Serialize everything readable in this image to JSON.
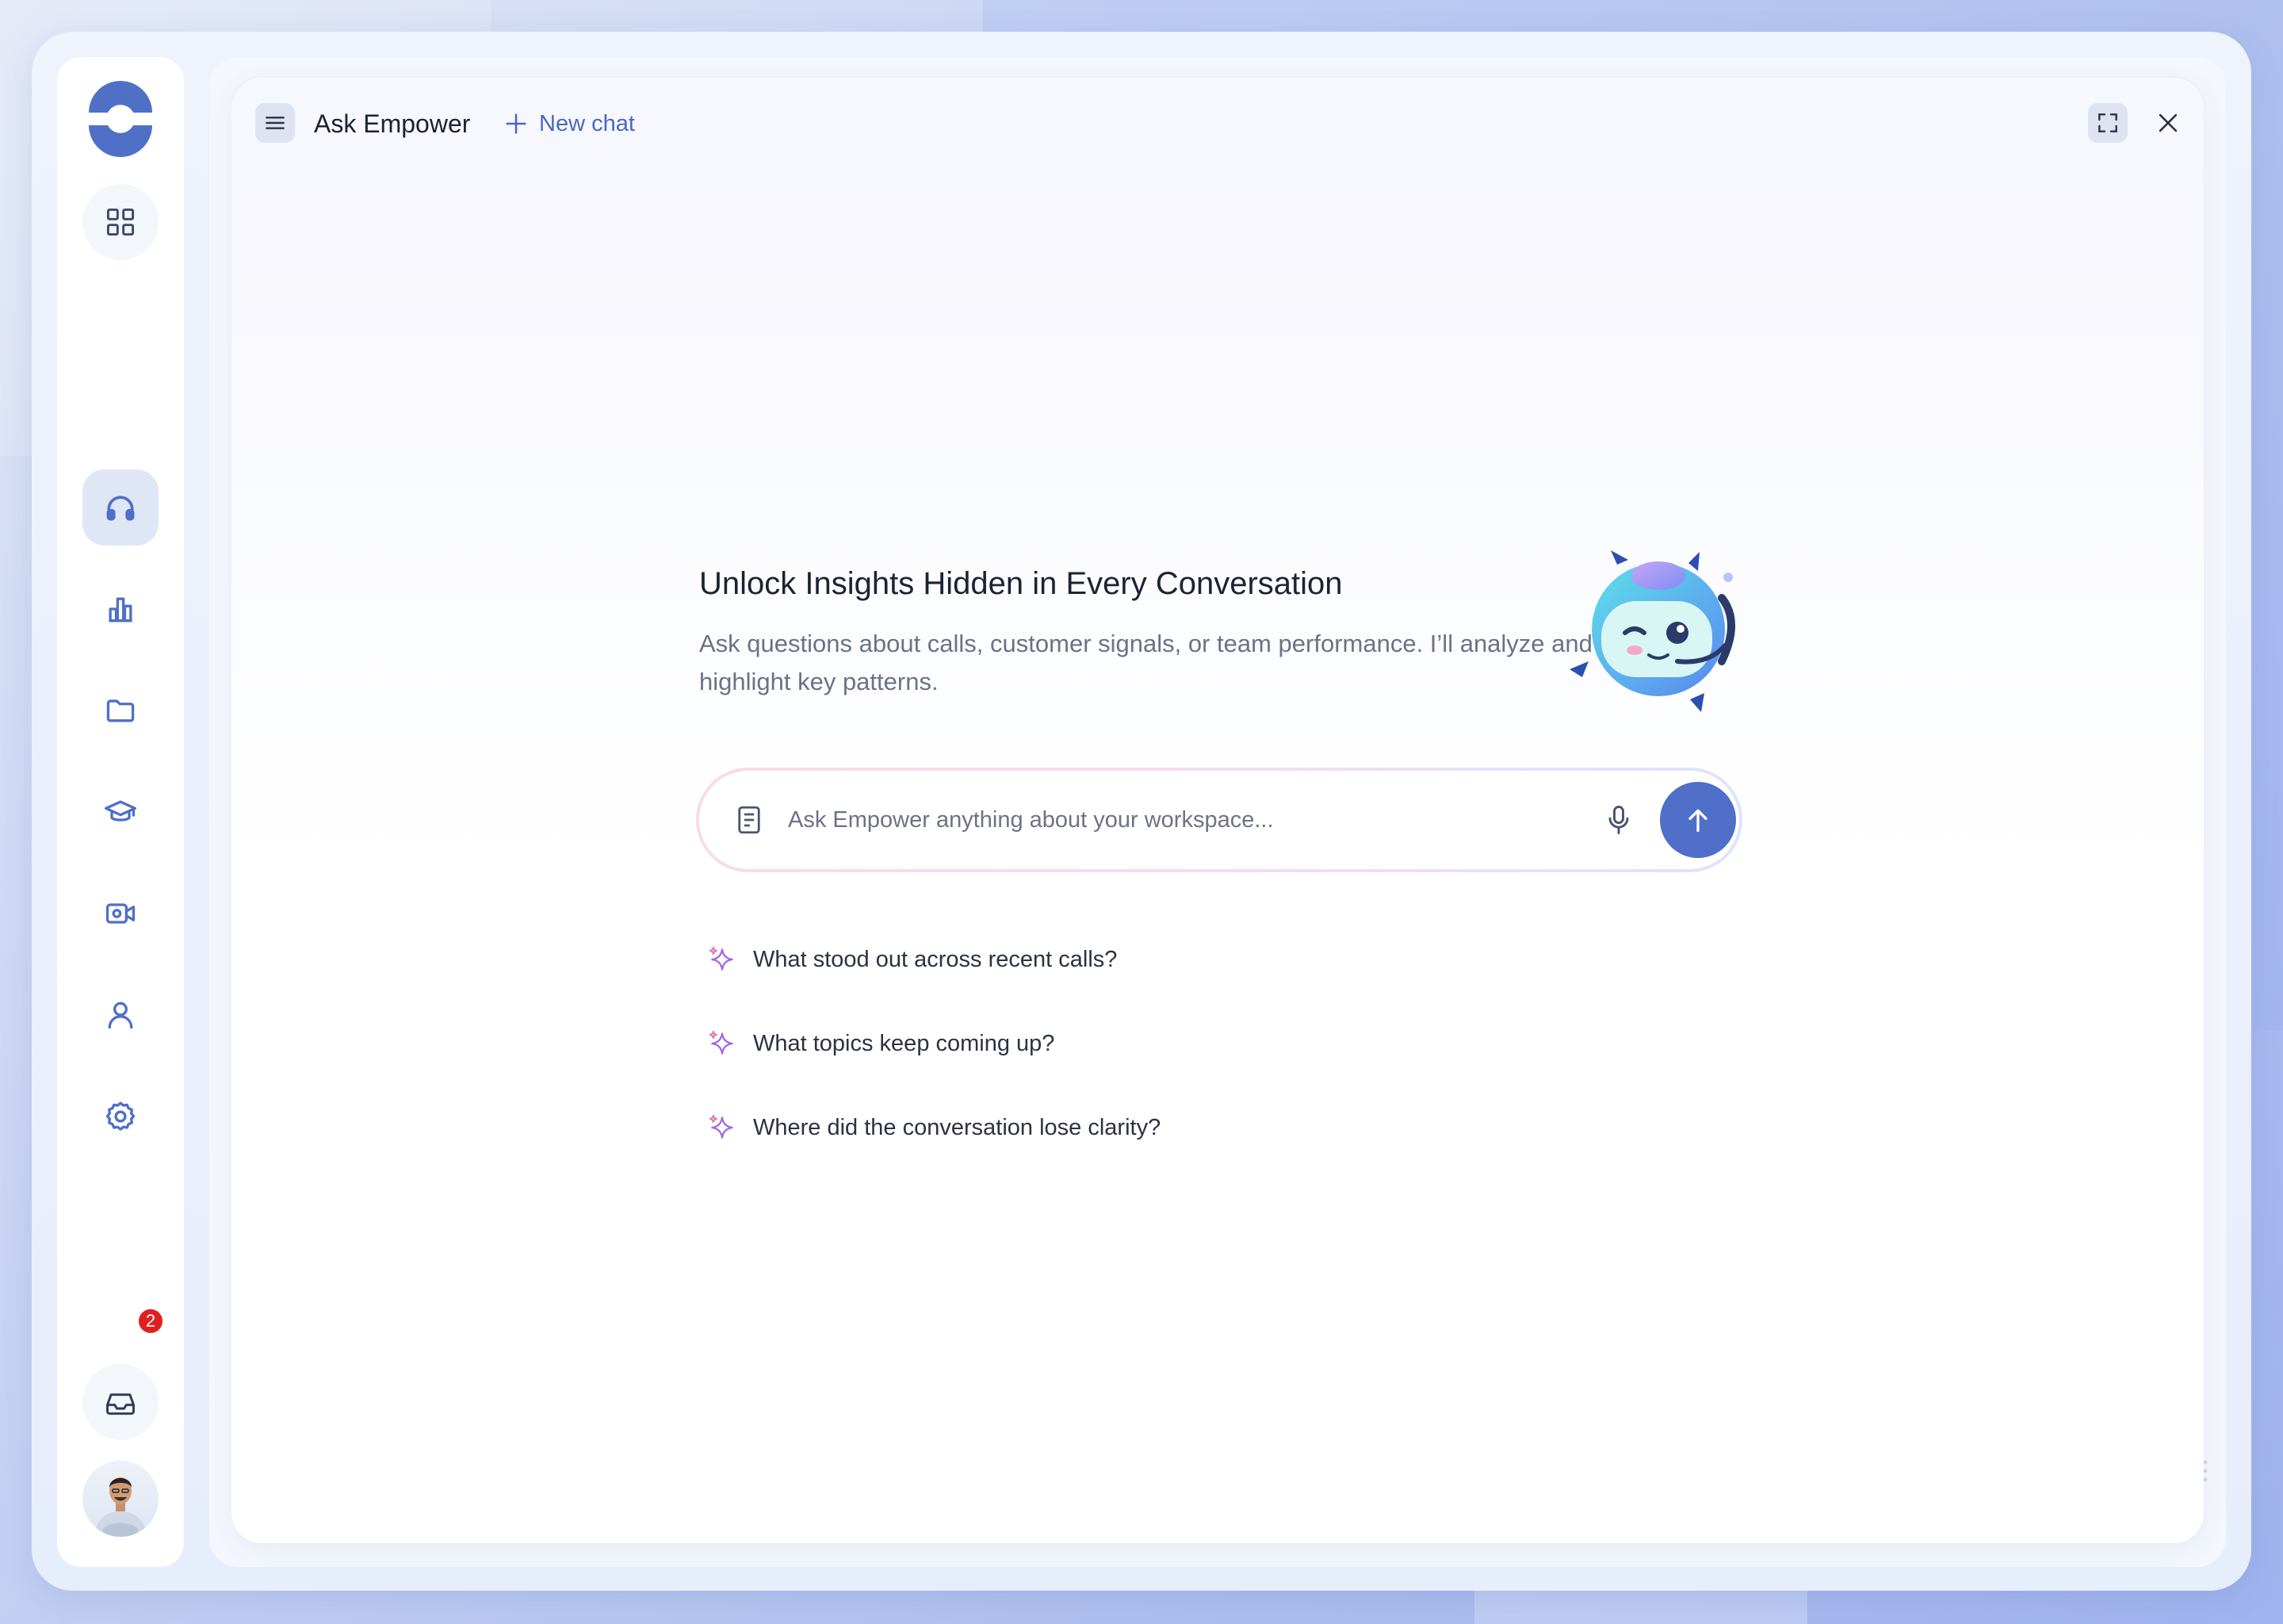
{
  "app": {
    "title": "Ask Empower",
    "new_chat_label": "New chat"
  },
  "sidebar": {
    "items": [
      {
        "name": "dashboard",
        "icon": "grid-icon"
      },
      {
        "name": "calls",
        "icon": "headphones-icon",
        "active": true
      },
      {
        "name": "analytics",
        "icon": "bar-chart-icon"
      },
      {
        "name": "library",
        "icon": "folder-icon"
      },
      {
        "name": "training",
        "icon": "graduation-cap-icon"
      },
      {
        "name": "recordings",
        "icon": "video-camera-icon"
      },
      {
        "name": "profile",
        "icon": "user-icon"
      },
      {
        "name": "settings",
        "icon": "gear-icon"
      }
    ],
    "inbox": {
      "icon": "inbox-icon",
      "badge_count": "2"
    }
  },
  "hero": {
    "title": "Unlock Insights Hidden in Every Conversation",
    "subtitle": "Ask questions about calls, customer signals, or team performance. I’ll analyze and highlight key patterns."
  },
  "composer": {
    "placeholder": "Ask Empower anything about your workspace...",
    "value": ""
  },
  "suggestions": [
    "What stood out across recent calls?",
    "What topics keep coming up?",
    "Where did the conversation lose clarity?"
  ],
  "colors": {
    "accent": "#4f6fc8",
    "badge": "#e02020",
    "text_primary": "#1c2333",
    "text_secondary": "#6a7385"
  }
}
